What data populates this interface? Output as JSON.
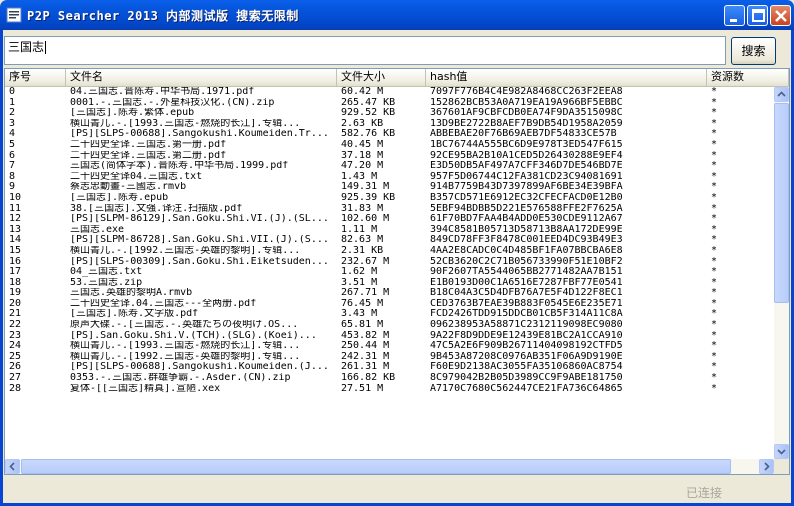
{
  "window": {
    "title": "P2P Searcher 2013 内部测试版 搜索无限制",
    "icons": [
      "app-icon",
      "minimize-icon",
      "maximize-icon",
      "close-icon"
    ]
  },
  "search": {
    "value": "三国志",
    "button_label": "搜索"
  },
  "columns": [
    "序号",
    "文件名",
    "文件大小",
    "hash值",
    "资源数"
  ],
  "rows": [
    [
      "0",
      "04.三国志.晋陈寿.中华书局.1971.pdf",
      "60.42 M",
      "7097F776B4C4E982A8468CC263F2EEA8",
      "*"
    ],
    [
      "1",
      "0001.-.三国志.-.外星科技汉化.(CN).zip",
      "265.47 KB",
      "152862BCB53A0A719EA19A966BF5EBBC",
      "*"
    ],
    [
      "2",
      "[三国志].陈寿.繁体.epub",
      "929.52 KB",
      "367601AF9CBFCDB0EA74F9DA3515098C",
      "*"
    ],
    [
      "3",
      "横山菁儿.-.[1993.三国志-燃烧的长江].专辑...",
      "2.63 KB",
      "13D9BE2722B8AEF7B9DB54D1958A2059",
      "*"
    ],
    [
      "4",
      "[PS][SLPS-00688].Sangokushi.Koumeiden.Tr...",
      "582.76 KB",
      "ABBEBAE20F76B69AEB7DF54833CE57B",
      "*"
    ],
    [
      "5",
      "二十四史全译.三国志.第一册.pdf",
      "40.45 M",
      "1BC76744A555BC6D9E978T3ED547F615",
      "*"
    ],
    [
      "6",
      "二十四史全译.三国志.第二册.pdf",
      "37.18 M",
      "92CE95BA2B10A1CED5D26430288E9EF4",
      "*"
    ],
    [
      "7",
      "三国志(简体字本).晋陈寿.中华书局.1999.pdf",
      "47.20 M",
      "E3D50DB5AF497A7CFF346D7DE546BD7E",
      "*"
    ],
    [
      "8",
      "二十四史全译04.三国志.txt",
      "1.43 M",
      "957F5D06744C12FA381CD23C94081691",
      "*"
    ],
    [
      "9",
      "蔡志忠動畫-三國志.rmvb",
      "149.31 M",
      "914B7759B43D7397899AF6BE34E39BFA",
      "*"
    ],
    [
      "10",
      "[三国志].陈寿.epub",
      "925.39 KB",
      "B357CD571E6912EC32CFECFACD0E12B0",
      "*"
    ],
    [
      "11",
      "38.[三国志].文强.译注.扫描版.pdf",
      "31.83 M",
      "5EBF94BDBB5D221E576588FFE2F7625A",
      "*"
    ],
    [
      "12",
      "[PS][SLPM-86129].San.Goku.Shi.VI.(J).(SL...",
      "102.60 M",
      "61F70BD7FAA4B4ADD0E530CDE9112A67",
      "*"
    ],
    [
      "13",
      "三国志.exe",
      "1.11 M",
      "394C8581B05713D58713B8AA172DE99E",
      "*"
    ],
    [
      "14",
      "[PS][SLPM-86728].San.Goku.Shi.VII.(J).(S...",
      "82.63 M",
      "849CD78FF3F8478C001EED4DC93B49E3",
      "*"
    ],
    [
      "15",
      "横山菁儿.-.[1992.三国志-英雄的黎明].专辑...",
      "2.31 KB",
      "4AA2E8CADC0C4D485BF1FA07BBCBA6E8",
      "*"
    ],
    [
      "16",
      "[PS][SLPS-00309].San.Goku.Shi.Eiketsuden...",
      "232.67 M",
      "52CB3620C2C71B056733990F51E10BF2",
      "*"
    ],
    [
      "17",
      "04_三国志.txt",
      "1.62 M",
      "90F2607TA5544065BB2771482AA7B151",
      "*"
    ],
    [
      "18",
      "53.三国志.zip",
      "3.51 M",
      "E1B0193D00C1A6516E7287FBF77E0541",
      "*"
    ],
    [
      "19",
      "三国志.英雄的黎明A.rmvb",
      "267.71 M",
      "B18C04A3C5D4DFB76A7E5F4D122F8EC1",
      "*"
    ],
    [
      "20",
      "二十四史全译.04.三国志---全两册.pdf",
      "76.45 M",
      "CED3763B7EAE39B883F0545E6E235E71",
      "*"
    ],
    [
      "21",
      "[三国志].陈寿.文字版.pdf",
      "3.43 M",
      "FCD2426TDD915DDCB01CB5F314A11C8A",
      "*"
    ],
    [
      "22",
      "原声大碟.-.[三国志.-.英雄たちの夜明け.OS...",
      "65.81 M",
      "096238953A58871C2312119098EC9080",
      "*"
    ],
    [
      "23",
      "[PS].San.Goku.Shi.V.(TCH).(SLG).(Koei)...",
      "453.82 M",
      "9A22F8D9DDE9E12439E81BC2A1CCA910",
      "*"
    ],
    [
      "24",
      "横山菁儿.-.[1993.三国志-燃烧的长江].专辑...",
      "250.44 M",
      "47C5A2E6F909B26711404098192CTFD5",
      "*"
    ],
    [
      "25",
      "横山菁儿.-.[1992.三国志-英雄的黎明].专辑...",
      "242.31 M",
      "9B453A87208C0976AB351F06A9D9190E",
      "*"
    ],
    [
      "26",
      "[PS][SLPS-00688].Sangokushi.Koumeiden.(J...",
      "261.31 M",
      "F60E9D2138AC3055FA35106860AC8754",
      "*"
    ],
    [
      "27",
      "0353.-.三国志.群雄争霸.-.Asder.(CN).zip",
      "166.82 KB",
      "8C979042B2B05D3989CC9F9ABE181750",
      "*"
    ],
    [
      "28",
      "复体-[[三国志]精真].宣陋.xex",
      "27.51 M",
      "A7170C7680C562447CE21FA736C64865",
      "*"
    ]
  ],
  "status": "已连接"
}
